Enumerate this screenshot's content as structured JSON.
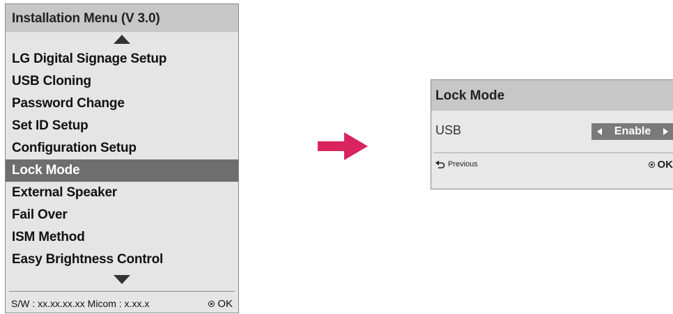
{
  "menu": {
    "title": "Installation Menu (V 3.0)",
    "items": [
      {
        "label": "LG Digital Signage Setup",
        "selected": false
      },
      {
        "label": "USB Cloning",
        "selected": false
      },
      {
        "label": "Password Change",
        "selected": false
      },
      {
        "label": "Set ID Setup",
        "selected": false
      },
      {
        "label": "Configuration Setup",
        "selected": false
      },
      {
        "label": "Lock Mode",
        "selected": true
      },
      {
        "label": "External Speaker",
        "selected": false
      },
      {
        "label": "Fail Over",
        "selected": false
      },
      {
        "label": "ISM Method",
        "selected": false
      },
      {
        "label": "Easy Brightness Control",
        "selected": false
      }
    ],
    "footer_info": "S/W : xx.xx.xx.xx Micom : x.xx.x",
    "ok_label": "OK"
  },
  "lock_mode": {
    "title": "Lock Mode",
    "usb_label": "USB",
    "usb_value": "Enable",
    "previous_label": "Previous",
    "ok_label": "OK"
  },
  "colors": {
    "panel_bg": "#e5e5e5",
    "header_bg": "#c7c7c7",
    "selected_bg": "#6e6e6e",
    "arrow": "#d9245f"
  }
}
